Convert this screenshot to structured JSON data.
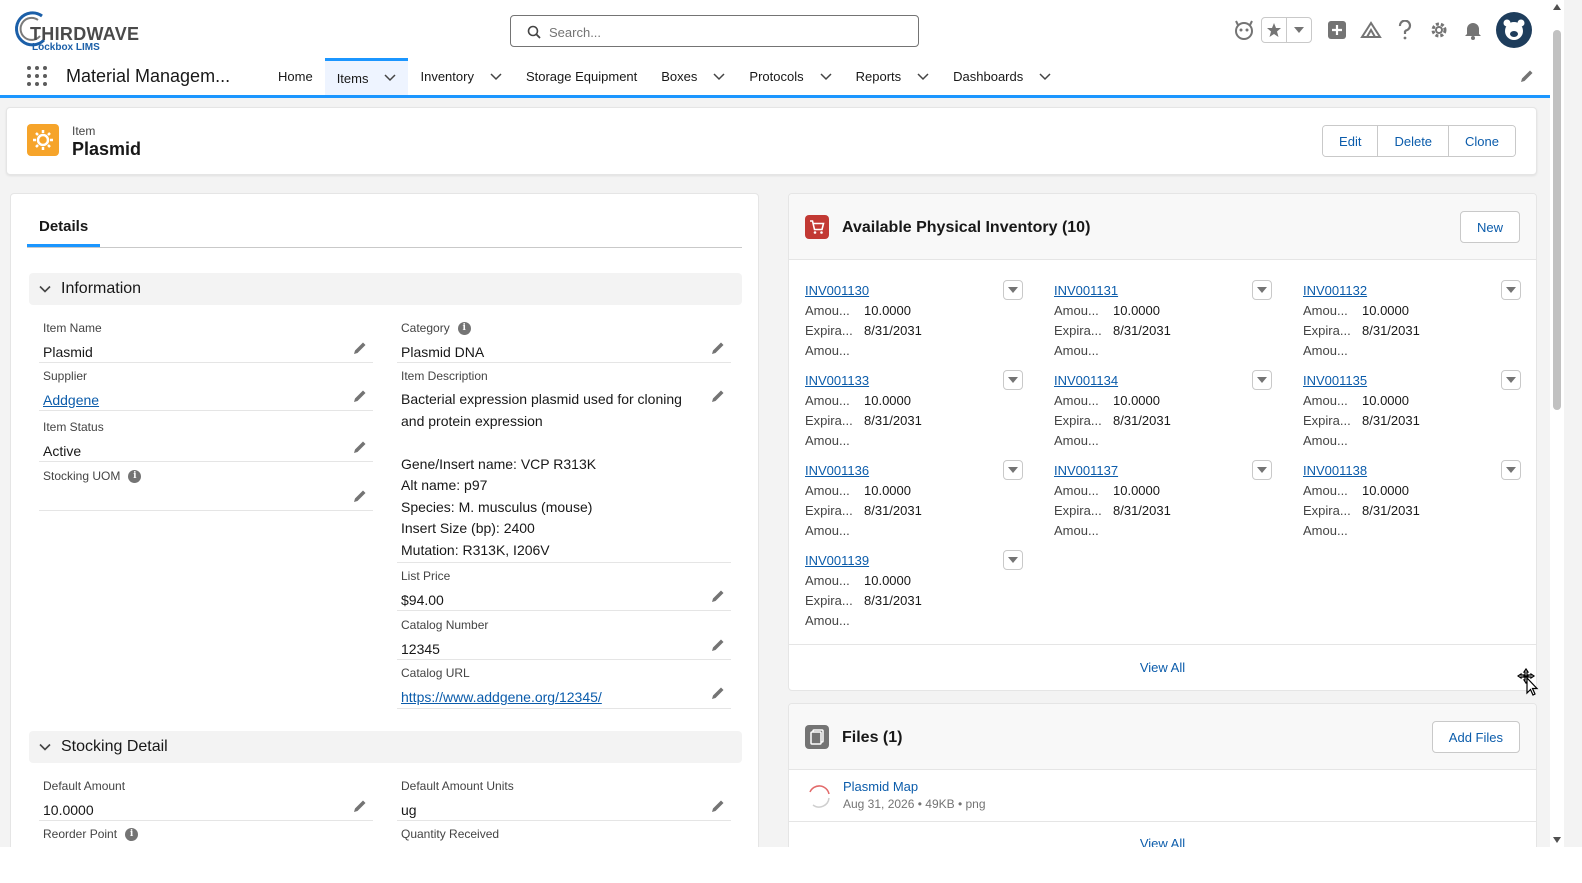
{
  "header": {
    "logo_main": "THIRDWAVE",
    "logo_sub": "Lockbox LIMS",
    "search_placeholder": "Search..."
  },
  "nav": {
    "app_name": "Material Managem...",
    "items": [
      {
        "label": "Home",
        "has_menu": false,
        "active": false
      },
      {
        "label": "Items",
        "has_menu": true,
        "active": true
      },
      {
        "label": "Inventory",
        "has_menu": true,
        "active": false
      },
      {
        "label": "Storage Equipment",
        "has_menu": false,
        "active": false
      },
      {
        "label": "Boxes",
        "has_menu": true,
        "active": false
      },
      {
        "label": "Protocols",
        "has_menu": true,
        "active": false
      },
      {
        "label": "Reports",
        "has_menu": true,
        "active": false
      },
      {
        "label": "Dashboards",
        "has_menu": true,
        "active": false
      }
    ]
  },
  "record": {
    "type": "Item",
    "title": "Plasmid",
    "actions": [
      "Edit",
      "Delete",
      "Clone"
    ]
  },
  "details": {
    "tab": "Details",
    "information_label": "Information",
    "item_name_label": "Item Name",
    "item_name": "Plasmid",
    "supplier_label": "Supplier",
    "supplier": "Addgene",
    "item_status_label": "Item Status",
    "item_status": "Active",
    "stocking_uom_label": "Stocking UOM",
    "stocking_uom": "",
    "category_label": "Category",
    "category": "Plasmid DNA",
    "item_description_label": "Item Description",
    "item_description_lines": [
      "Bacterial expression plasmid used for cloning",
      "and protein expression",
      "",
      "Gene/Insert name: VCP R313K",
      "Alt name: p97",
      "Species: M. musculus (mouse)",
      "Insert Size (bp): 2400",
      "Mutation: R313K, I206V"
    ],
    "list_price_label": "List Price",
    "list_price": "$94.00",
    "catalog_number_label": "Catalog Number",
    "catalog_number": "12345",
    "catalog_url_label": "Catalog URL",
    "catalog_url": "https://www.addgene.org/12345/",
    "stocking_detail_label": "Stocking Detail",
    "default_amount_label": "Default Amount",
    "default_amount": "10.0000",
    "default_amount_units_label": "Default Amount Units",
    "default_amount_units": "ug",
    "reorder_point_label": "Reorder Point",
    "quantity_received_label": "Quantity Received"
  },
  "inventory": {
    "title": "Available Physical Inventory (10)",
    "new_label": "New",
    "row_labels": {
      "amount": "Amou...",
      "expiration": "Expira...",
      "amount2": "Amou..."
    },
    "tiles": [
      {
        "id": "INV001130",
        "amount": "10.0000",
        "expiration": "8/31/2031"
      },
      {
        "id": "INV001131",
        "amount": "10.0000",
        "expiration": "8/31/2031"
      },
      {
        "id": "INV001132",
        "amount": "10.0000",
        "expiration": "8/31/2031"
      },
      {
        "id": "INV001133",
        "amount": "10.0000",
        "expiration": "8/31/2031"
      },
      {
        "id": "INV001134",
        "amount": "10.0000",
        "expiration": "8/31/2031"
      },
      {
        "id": "INV001135",
        "amount": "10.0000",
        "expiration": "8/31/2031"
      },
      {
        "id": "INV001136",
        "amount": "10.0000",
        "expiration": "8/31/2031"
      },
      {
        "id": "INV001137",
        "amount": "10.0000",
        "expiration": "8/31/2031"
      },
      {
        "id": "INV001138",
        "amount": "10.0000",
        "expiration": "8/31/2031"
      },
      {
        "id": "INV001139",
        "amount": "10.0000",
        "expiration": "8/31/2031"
      }
    ],
    "view_all": "View All"
  },
  "files": {
    "title": "Files (1)",
    "add_label": "Add Files",
    "items": [
      {
        "name": "Plasmid Map",
        "meta": "Aug 31, 2026 • 49KB • png"
      }
    ],
    "view_all": "View All"
  },
  "colors": {
    "brand_blue": "#1b96ff",
    "link": "#0b5cab",
    "item_icon": "#f6a42a",
    "inventory_icon": "#c23934",
    "files_icon": "#747474"
  },
  "icons": {
    "search": "search-icon",
    "assistant": "assistant-icon",
    "favorite": "star-icon",
    "add": "plus-icon",
    "trailhead": "trailhead-icon",
    "help": "help-icon",
    "setup": "gear-icon",
    "notifications": "bell-icon"
  }
}
